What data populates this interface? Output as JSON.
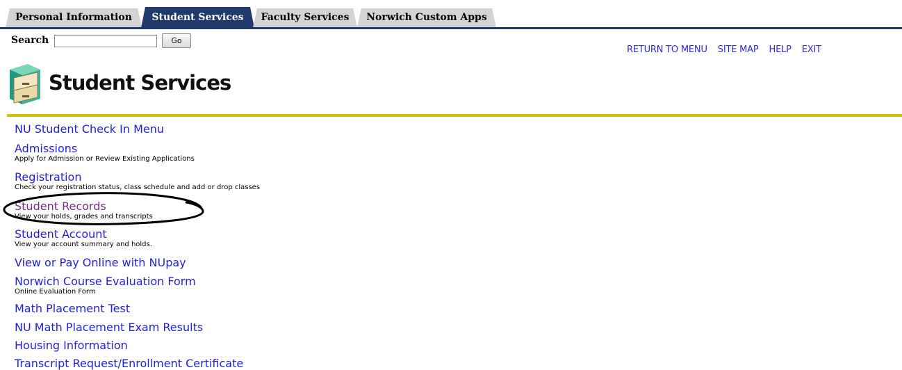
{
  "tabs": [
    {
      "label": "Personal Information",
      "active": false
    },
    {
      "label": "Student Services",
      "active": true
    },
    {
      "label": "Faculty Services",
      "active": false
    },
    {
      "label": "Norwich Custom Apps",
      "active": false
    }
  ],
  "search": {
    "label": "Search",
    "value": "",
    "button": "Go"
  },
  "top_links": [
    "RETURN TO MENU",
    "SITE MAP",
    "HELP",
    "EXIT"
  ],
  "page_title": "Student Services",
  "logo_icon": "file-cabinet-icon",
  "menu": [
    {
      "label": "NU Student Check In Menu",
      "desc": ""
    },
    {
      "label": "Admissions",
      "desc": "Apply for Admission or Review Existing Applications"
    },
    {
      "label": "Registration",
      "desc": "Check your registration status, class schedule and add or drop classes"
    },
    {
      "label": "Student Records",
      "desc": "View your holds, grades and transcripts"
    },
    {
      "label": "Student Account",
      "desc": "View your account summary and holds."
    },
    {
      "label": "View or Pay Online with NUpay",
      "desc": ""
    },
    {
      "label": "Norwich Course Evaluation Form",
      "desc": "Online Evaluation Form"
    },
    {
      "label": "Math Placement Test",
      "desc": ""
    },
    {
      "label": "NU Math Placement Exam Results",
      "desc": ""
    },
    {
      "label": "Housing Information",
      "desc": ""
    },
    {
      "label": "Transcript Request/Enrollment Certificate",
      "desc": ""
    }
  ],
  "colors": {
    "tab_active": "#1f3a6b",
    "link": "#2222dd",
    "visited": "#7a2a8c",
    "rule": "#c8c800"
  }
}
